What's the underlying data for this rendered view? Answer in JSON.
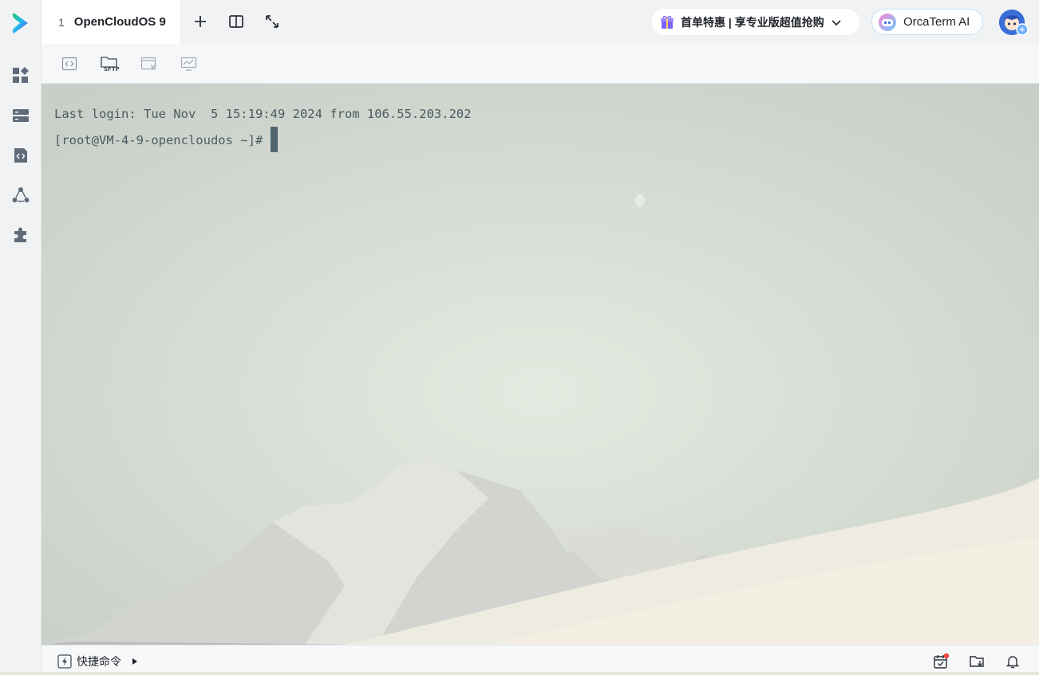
{
  "sidebar": {
    "items": [
      {
        "name": "dashboard-icon"
      },
      {
        "name": "server-list-icon"
      },
      {
        "name": "code-file-icon"
      },
      {
        "name": "share-network-icon"
      },
      {
        "name": "plugin-icon"
      }
    ]
  },
  "tab": {
    "number": "1",
    "title": "OpenCloudOS 9"
  },
  "topbar": {
    "promo_text": "首单特惠 | 享专业版超值抢购",
    "ai_label": "OrcaTerm AI"
  },
  "toolbar": {
    "sftp_label": "SFTP"
  },
  "terminal": {
    "line1": "Last login: Tue Nov  5 15:19:49 2024 from 106.55.203.202",
    "prompt": "[root@VM-4-9-opencloudos ~]# "
  },
  "statusbar": {
    "quick_label": "快捷命令"
  },
  "colors": {
    "accent": "#2f6fe4",
    "notification_dot": "#f04438",
    "promo_gift": "#7b61ff"
  }
}
